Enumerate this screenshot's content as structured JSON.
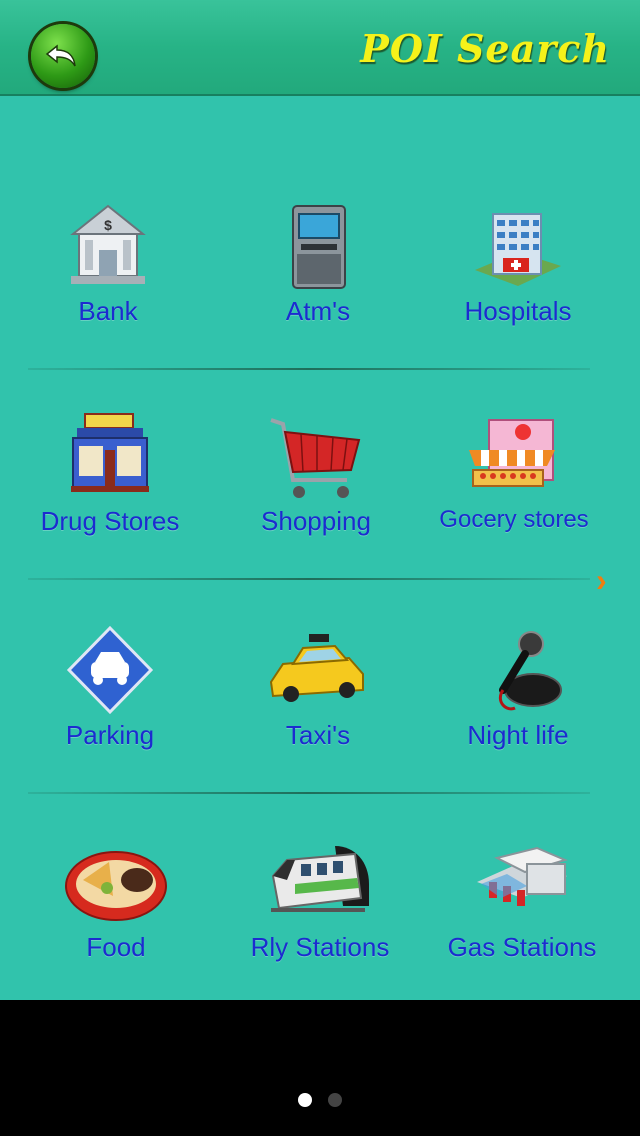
{
  "header": {
    "title": "POI Search",
    "back_icon": "back-arrow-icon"
  },
  "categories": [
    {
      "label": "Bank",
      "icon": "bank-icon"
    },
    {
      "label": "Atm's",
      "icon": "atm-icon"
    },
    {
      "label": "Hospitals",
      "icon": "hospital-icon"
    },
    {
      "label": "Drug Stores",
      "icon": "drug-store-icon"
    },
    {
      "label": "Shopping",
      "icon": "shopping-cart-icon"
    },
    {
      "label": "Gocery stores",
      "icon": "grocery-store-icon"
    },
    {
      "label": "Parking",
      "icon": "parking-icon"
    },
    {
      "label": "Taxi's",
      "icon": "taxi-icon"
    },
    {
      "label": "Night life",
      "icon": "microphone-icon"
    },
    {
      "label": "Food",
      "icon": "food-plate-icon"
    },
    {
      "label": "Rly Stations",
      "icon": "train-icon"
    },
    {
      "label": "Gas Stations",
      "icon": "gas-station-icon"
    }
  ],
  "pager": {
    "pages": 2,
    "current": 1,
    "next_icon": "chevron-right-icon"
  },
  "colors": {
    "background": "#31c3ac",
    "label": "#1c2bd0",
    "title": "#f5f21a"
  }
}
